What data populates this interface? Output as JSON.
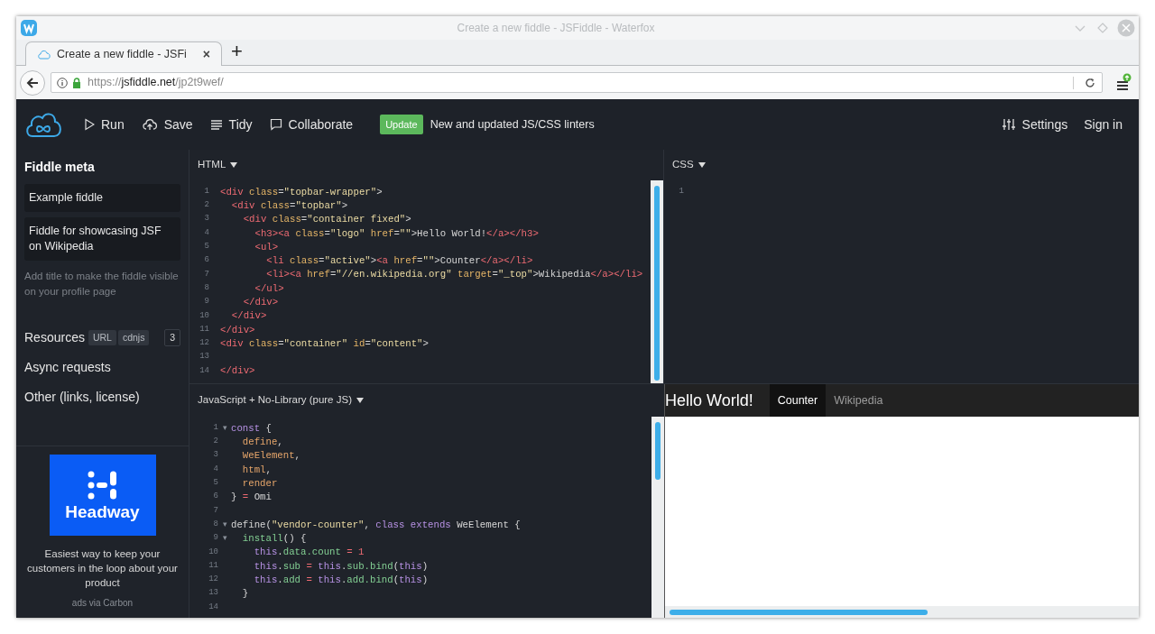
{
  "browser": {
    "title": "Create a new fiddle - JSFiddle - Waterfox",
    "tab": {
      "title": "Create a new fiddle - JSFi",
      "close": "×"
    },
    "new_tab": "+",
    "url": {
      "scheme": "https://",
      "host": "jsfiddle.net",
      "path": "/jp2t9wef/"
    }
  },
  "header": {
    "nav": [
      {
        "label": "Run"
      },
      {
        "label": "Save"
      },
      {
        "label": "Tidy"
      },
      {
        "label": "Collaborate"
      }
    ],
    "update": {
      "badge": "Update",
      "text": "New and updated JS/CSS linters"
    },
    "right": [
      {
        "label": "Settings"
      },
      {
        "label": "Sign in"
      }
    ]
  },
  "sidebar": {
    "title": "Fiddle meta",
    "fields": [
      {
        "value": "Example fiddle"
      },
      {
        "value": "Fiddle for showcasing JSF on Wikipedia"
      }
    ],
    "hint": "Add title to make the fiddle visible on your profile page",
    "sections": [
      {
        "label": "Resources",
        "tags": [
          "URL",
          "cdnjs"
        ],
        "count": "3"
      },
      {
        "label": "Async requests"
      },
      {
        "label": "Other (links, license)"
      }
    ],
    "ad": {
      "logo_text": "Headway",
      "text": "Easiest way to keep your customers in the loop about your product",
      "via": "ads via Carbon"
    }
  },
  "html_panel": {
    "label": "HTML",
    "lines": [
      {
        "number": "1",
        "tokens": [
          {
            "kind": "tag",
            "text": "<div"
          },
          {
            "kind": "attr",
            "text": " class"
          },
          {
            "kind": "plain",
            "text": "="
          },
          {
            "kind": "string",
            "text": "\"topbar-wrapper\""
          },
          {
            "kind": "plain",
            "text": ">"
          }
        ]
      },
      {
        "number": "2",
        "tokens": [
          {
            "kind": "tag",
            "text": "  <div"
          },
          {
            "kind": "attr",
            "text": " class"
          },
          {
            "kind": "plain",
            "text": "="
          },
          {
            "kind": "string",
            "text": "\"topbar\""
          },
          {
            "kind": "plain",
            "text": ">"
          }
        ]
      },
      {
        "number": "3",
        "tokens": [
          {
            "kind": "tag",
            "text": "    <div"
          },
          {
            "kind": "attr",
            "text": " class"
          },
          {
            "kind": "plain",
            "text": "="
          },
          {
            "kind": "string",
            "text": "\"container fixed\""
          },
          {
            "kind": "plain",
            "text": ">"
          }
        ]
      },
      {
        "number": "4",
        "tokens": [
          {
            "kind": "tag",
            "text": "      <h3><a"
          },
          {
            "kind": "attr",
            "text": " class"
          },
          {
            "kind": "plain",
            "text": "="
          },
          {
            "kind": "string",
            "text": "\"logo\""
          },
          {
            "kind": "attr",
            "text": " href"
          },
          {
            "kind": "plain",
            "text": "="
          },
          {
            "kind": "string",
            "text": "\"\""
          },
          {
            "kind": "plain",
            "text": ">Hello World!"
          },
          {
            "kind": "tag",
            "text": "</a></h3>"
          }
        ]
      },
      {
        "number": "5",
        "tokens": [
          {
            "kind": "tag",
            "text": "      <ul>"
          }
        ]
      },
      {
        "number": "6",
        "tokens": [
          {
            "kind": "tag",
            "text": "        <li"
          },
          {
            "kind": "attr",
            "text": " class"
          },
          {
            "kind": "plain",
            "text": "="
          },
          {
            "kind": "string",
            "text": "\"active\""
          },
          {
            "kind": "plain",
            "text": ">"
          },
          {
            "kind": "tag",
            "text": "<a"
          },
          {
            "kind": "attr",
            "text": " href"
          },
          {
            "kind": "plain",
            "text": "="
          },
          {
            "kind": "string",
            "text": "\"\""
          },
          {
            "kind": "plain",
            "text": ">Counter"
          },
          {
            "kind": "tag",
            "text": "</a></li>"
          }
        ]
      },
      {
        "number": "7",
        "tokens": [
          {
            "kind": "tag",
            "text": "        <li><a"
          },
          {
            "kind": "attr",
            "text": " href"
          },
          {
            "kind": "plain",
            "text": "="
          },
          {
            "kind": "string",
            "text": "\"//en.wikipedia.org\""
          },
          {
            "kind": "attr",
            "text": " target"
          },
          {
            "kind": "plain",
            "text": "="
          },
          {
            "kind": "string",
            "text": "\"_top\""
          },
          {
            "kind": "plain",
            "text": ">Wikipedia"
          },
          {
            "kind": "tag",
            "text": "</a></li>"
          }
        ]
      },
      {
        "number": "8",
        "tokens": [
          {
            "kind": "tag",
            "text": "      </ul>"
          }
        ]
      },
      {
        "number": "9",
        "tokens": [
          {
            "kind": "tag",
            "text": "    </div>"
          }
        ]
      },
      {
        "number": "10",
        "tokens": [
          {
            "kind": "tag",
            "text": "  </div>"
          }
        ]
      },
      {
        "number": "11",
        "tokens": [
          {
            "kind": "tag",
            "text": "</div>"
          }
        ]
      },
      {
        "number": "12",
        "tokens": [
          {
            "kind": "tag",
            "text": "<div"
          },
          {
            "kind": "attr",
            "text": " class"
          },
          {
            "kind": "plain",
            "text": "="
          },
          {
            "kind": "string",
            "text": "\"container\""
          },
          {
            "kind": "attr",
            "text": " id"
          },
          {
            "kind": "plain",
            "text": "="
          },
          {
            "kind": "string",
            "text": "\"content\""
          },
          {
            "kind": "plain",
            "text": ">"
          }
        ]
      },
      {
        "number": "13"
      },
      {
        "number": "14",
        "tokens": [
          {
            "kind": "tag",
            "text": "</div>"
          }
        ]
      }
    ]
  },
  "css_panel": {
    "label": "CSS",
    "lines": [
      {
        "number": "1"
      }
    ]
  },
  "js_panel": {
    "label": "JavaScript + No-Library (pure JS)",
    "lines": [
      {
        "number": "1",
        "fold": "▾",
        "tokens": [
          {
            "kind": "keyword",
            "text": "const"
          },
          {
            "kind": "plain",
            "text": " {"
          }
        ]
      },
      {
        "number": "2",
        "tokens": [
          {
            "kind": "var",
            "text": "  define"
          },
          {
            "kind": "plain",
            "text": ","
          }
        ]
      },
      {
        "number": "3",
        "tokens": [
          {
            "kind": "var",
            "text": "  WeElement"
          },
          {
            "kind": "plain",
            "text": ","
          }
        ]
      },
      {
        "number": "4",
        "tokens": [
          {
            "kind": "var",
            "text": "  html"
          },
          {
            "kind": "plain",
            "text": ","
          }
        ]
      },
      {
        "number": "5",
        "tokens": [
          {
            "kind": "var",
            "text": "  render"
          }
        ]
      },
      {
        "number": "6",
        "tokens": [
          {
            "kind": "plain",
            "text": "}"
          },
          {
            "kind": "op",
            "text": " ="
          },
          {
            "kind": "plain",
            "text": " Omi"
          }
        ]
      },
      {
        "number": "7"
      },
      {
        "number": "8",
        "fold": "▾",
        "tokens": [
          {
            "kind": "plain",
            "text": "define("
          },
          {
            "kind": "string",
            "text": "\"vendor-counter\""
          },
          {
            "kind": "plain",
            "text": ","
          },
          {
            "kind": "keyword",
            "text": " class extends"
          },
          {
            "kind": "plain",
            "text": " WeElement {"
          }
        ]
      },
      {
        "number": "9",
        "fold": "▾",
        "tokens": [
          {
            "kind": "func",
            "text": "  install"
          },
          {
            "kind": "plain",
            "text": "() {"
          }
        ]
      },
      {
        "number": "10",
        "tokens": [
          {
            "kind": "keyword",
            "text": "    this"
          },
          {
            "kind": "plain",
            "text": "."
          },
          {
            "kind": "func",
            "text": "data.count"
          },
          {
            "kind": "op",
            "text": " ="
          },
          {
            "kind": "number",
            "text": " 1"
          }
        ]
      },
      {
        "number": "11",
        "tokens": [
          {
            "kind": "keyword",
            "text": "    this"
          },
          {
            "kind": "plain",
            "text": "."
          },
          {
            "kind": "func",
            "text": "sub"
          },
          {
            "kind": "op",
            "text": " ="
          },
          {
            "kind": "keyword",
            "text": " this"
          },
          {
            "kind": "plain",
            "text": "."
          },
          {
            "kind": "func",
            "text": "sub.bind"
          },
          {
            "kind": "plain",
            "text": "("
          },
          {
            "kind": "keyword",
            "text": "this"
          },
          {
            "kind": "plain",
            "text": ")"
          }
        ]
      },
      {
        "number": "12",
        "tokens": [
          {
            "kind": "keyword",
            "text": "    this"
          },
          {
            "kind": "plain",
            "text": "."
          },
          {
            "kind": "func",
            "text": "add"
          },
          {
            "kind": "op",
            "text": " ="
          },
          {
            "kind": "keyword",
            "text": " this"
          },
          {
            "kind": "plain",
            "text": "."
          },
          {
            "kind": "func",
            "text": "add.bind"
          },
          {
            "kind": "plain",
            "text": "("
          },
          {
            "kind": "keyword",
            "text": "this"
          },
          {
            "kind": "plain",
            "text": ")"
          }
        ]
      },
      {
        "number": "13",
        "tokens": [
          {
            "kind": "plain",
            "text": "  }"
          }
        ]
      },
      {
        "number": "14"
      }
    ]
  },
  "result": {
    "brand": "Hello World!",
    "tabs": [
      {
        "label": "Counter",
        "selected": true
      },
      {
        "label": "Wikipedia",
        "selected": false
      }
    ]
  }
}
